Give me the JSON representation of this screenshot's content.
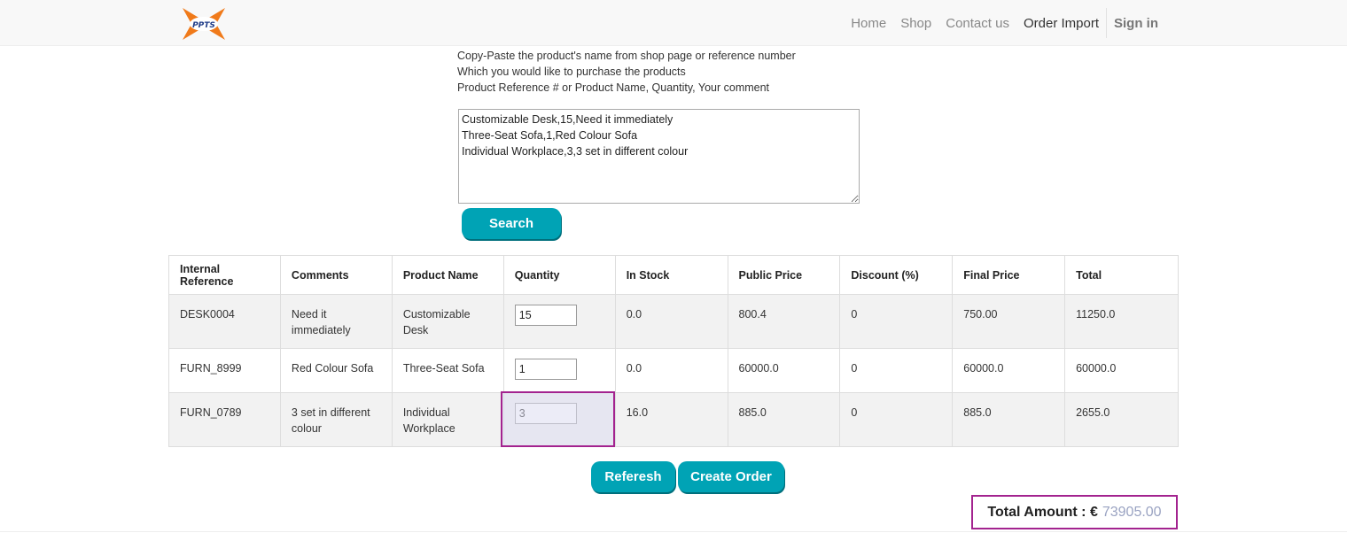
{
  "navbar": {
    "logo_text": "PPTS",
    "links": [
      "Home",
      "Shop",
      "Contact us",
      "Order Import"
    ],
    "signin": "Sign in"
  },
  "instructions": {
    "line1": "Copy-Paste the product's name from shop page or reference number",
    "line2": "Which you would like to purchase the products",
    "line3": "Product Reference # or Product Name, Quantity, Your comment"
  },
  "textarea": {
    "value": "Customizable Desk,15,Need it immediately\nThree-Seat Sofa,1,Red Colour Sofa\nIndividual Workplace,3,3 set in different colour"
  },
  "buttons": {
    "search": "Search",
    "refresh": "Referesh",
    "create_order": "Create Order"
  },
  "table": {
    "headers": [
      "Internal Reference",
      "Comments",
      "Product Name",
      "Quantity",
      "In Stock",
      "Public Price",
      "Discount (%)",
      "Final Price",
      "Total"
    ],
    "rows": [
      {
        "ref": "DESK0004",
        "comment": "Need it immediately",
        "product": "Customizable Desk",
        "qty": "15",
        "stock": "0.0",
        "public_price": "800.4",
        "discount": "0",
        "final_price": "750.00",
        "total": "11250.0"
      },
      {
        "ref": "FURN_8999",
        "comment": "Red Colour Sofa",
        "product": "Three-Seat Sofa",
        "qty": "1",
        "stock": "0.0",
        "public_price": "60000.0",
        "discount": "0",
        "final_price": "60000.0",
        "total": "60000.0"
      },
      {
        "ref": "FURN_0789",
        "comment": "3 set in different colour",
        "product": "Individual Workplace",
        "qty": "3",
        "stock": "16.0",
        "public_price": "885.0",
        "discount": "0",
        "final_price": "885.0",
        "total": "2655.0"
      }
    ]
  },
  "total": {
    "label": "Total Amount : €",
    "value": "73905.00"
  },
  "colors": {
    "accent": "#00a3b5",
    "highlight": "#a3238f",
    "out_of_stock": "#d9262d",
    "logo_orange": "#f07a1a"
  }
}
